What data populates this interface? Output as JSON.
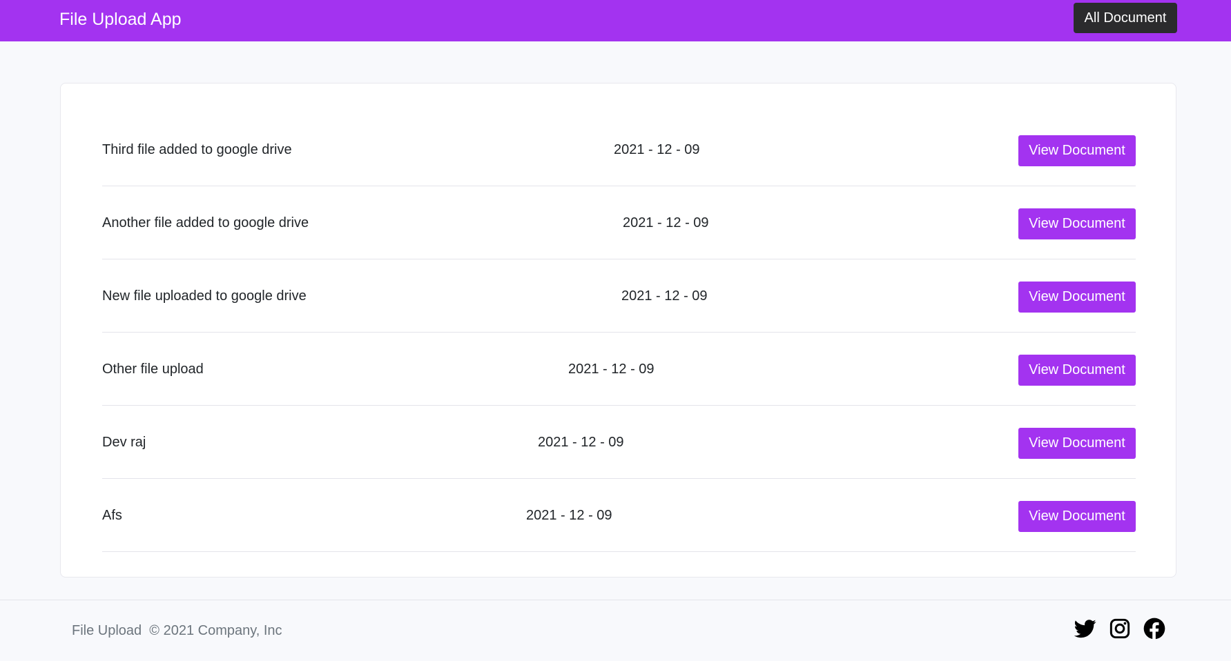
{
  "navbar": {
    "brand": "File Upload App",
    "all_documents_label": "All Document"
  },
  "documents": [
    {
      "name": "Third file added to google drive",
      "date": "2021 - 12 - 09",
      "action": "View Document"
    },
    {
      "name": "Another file added to google drive",
      "date": "2021 - 12 - 09",
      "action": "View Document"
    },
    {
      "name": "New file uploaded to google drive",
      "date": "2021 - 12 - 09",
      "action": "View Document"
    },
    {
      "name": "Other file upload",
      "date": "2021 - 12 - 09",
      "action": "View Document"
    },
    {
      "name": "Dev raj",
      "date": "2021 - 12 - 09",
      "action": "View Document"
    },
    {
      "name": "Afs",
      "date": "2021 - 12 - 09",
      "action": "View Document"
    }
  ],
  "footer": {
    "app_name": "File Upload",
    "copyright": "© 2021 Company, Inc",
    "social_icons": [
      "twitter-icon",
      "instagram-icon",
      "facebook-icon"
    ]
  },
  "colors": {
    "accent": "#a333f0",
    "dark_button": "#2b2b2d",
    "background": "#f8f9fc"
  }
}
